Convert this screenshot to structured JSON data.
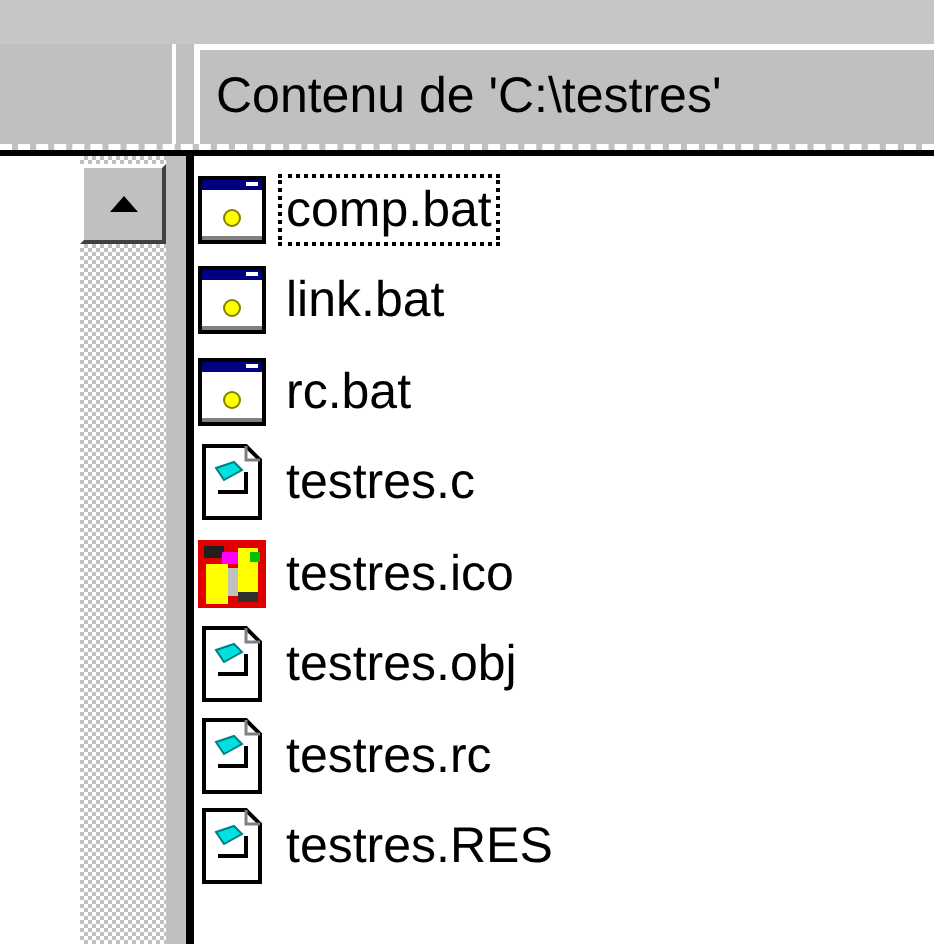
{
  "header": {
    "title": "Contenu de 'C:\\testres'"
  },
  "files": [
    {
      "name": "comp.bat",
      "kind": "bat",
      "focused": true
    },
    {
      "name": "link.bat",
      "kind": "bat",
      "focused": false
    },
    {
      "name": "rc.bat",
      "kind": "bat",
      "focused": false
    },
    {
      "name": "testres.c",
      "kind": "doc",
      "focused": false
    },
    {
      "name": "testres.ico",
      "kind": "ico",
      "focused": false
    },
    {
      "name": "testres.obj",
      "kind": "doc",
      "focused": false
    },
    {
      "name": "testres.rc",
      "kind": "doc",
      "focused": false
    },
    {
      "name": "testres.RES",
      "kind": "doc",
      "focused": false
    }
  ]
}
